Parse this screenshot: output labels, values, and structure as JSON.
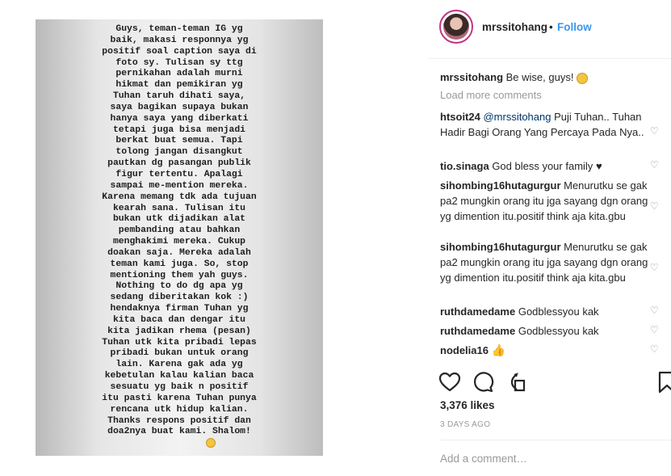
{
  "post": {
    "image_text": "Guys, teman-teman IG yg\nbaik, makasi responnya yg\npositif soal caption saya di\nfoto sy. Tulisan sy ttg\npernikahan adalah murni\nhikmat dan pemikiran yg\nTuhan taruh dihati saya,\nsaya bagikan supaya bukan\nhanya saya yang diberkati\ntetapi juga bisa menjadi\nberkat buat semua. Tapi\ntolong jangan disangkut\npautkan dg pasangan publik\nfigur tertentu. Apalagi\nsampai me-mention mereka.\nKarena memang tdk ada tujuan\nkearah sana. Tulisan itu\nbukan utk dijadikan alat\npembanding atau bahkan\nmenghakimi mereka. Cukup\ndoakan saja. Mereka adalah\nteman kami juga. So, stop\nmentioning them yah guys.\nNothing to do dg apa yg\nsedang diberitakan kok :)\nhendaknya firman Tuhan yg\nkita baca dan dengar itu\nkita jadikan rhema (pesan)\nTuhan utk kita pribadi lepas\npribadi bukan untuk orang\nlain. Karena gak ada yg\nkebetulan kalau kalian baca\nsesuatu yg baik n positif\nitu pasti karena Tuhan punya\nrencana utk hidup kalian.\nThanks respons positif dan\ndoa2nya buat kami. Shalom!"
  },
  "header": {
    "username": "mrssitohang",
    "separator": "•",
    "follow_label": "Follow"
  },
  "caption": {
    "username": "mrssitohang",
    "text": "Be wise, guys!"
  },
  "load_more": "Load more comments",
  "comments": [
    {
      "username": "htsoit24",
      "mention": "@mrssitohang",
      "text": "Puji Tuhan.. Tuhan Hadir Bagi Orang Yang Percaya Pada Nya.."
    },
    {
      "username": "tio.sinaga",
      "text": "God bless your family",
      "emoji": "♥"
    },
    {
      "username": "sihombing16hutagurgur",
      "text": "Menurutku se gak pa2 mungkin orang itu jga sayang dgn orang yg dimention itu.positif think aja kita.gbu"
    },
    {
      "username": "sihombing16hutagurgur",
      "text": "Menurutku se gak pa2 mungkin orang itu jga sayang dgn orang yg dimention itu.positif think aja kita.gbu"
    },
    {
      "username": "ruthdamedame",
      "text": "Godblessyou kak"
    },
    {
      "username": "ruthdamedame",
      "text": "Godblessyou kak"
    },
    {
      "username": "nodelia16",
      "emoji": "👍"
    }
  ],
  "icons": {
    "comment_heart": "♡",
    "like": "heart-outline-icon",
    "comment": "speech-bubble-icon",
    "share": "share-icon",
    "save": "bookmark-icon"
  },
  "likes": "3,376 likes",
  "timestamp": "3 DAYS AGO",
  "add_comment_placeholder": "Add a comment…",
  "colors": {
    "link_blue": "#3897f0",
    "secondary_text": "#999999",
    "primary_text": "#262626"
  }
}
